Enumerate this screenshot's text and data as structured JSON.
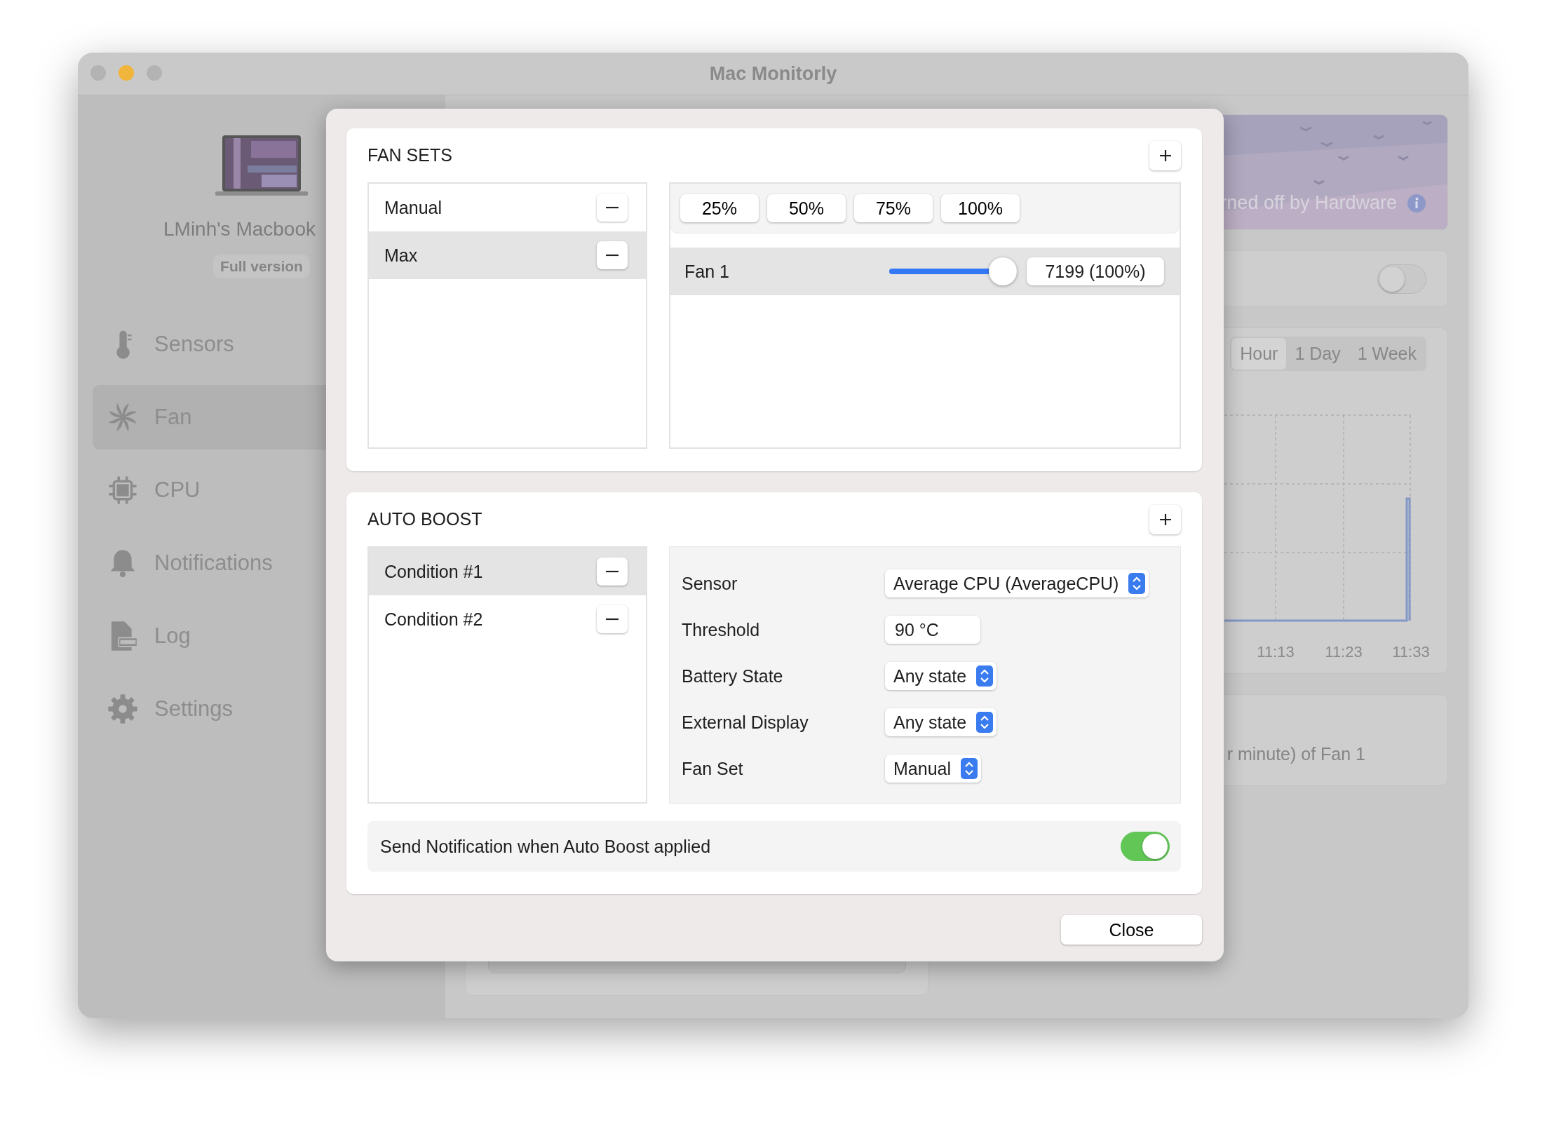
{
  "window": {
    "title": "Mac Monitorly"
  },
  "sidebar": {
    "device_name": "LMinh's Macbook",
    "badge": "Full version",
    "items": [
      {
        "label": "Sensors",
        "kind": "thermometer",
        "selected": false
      },
      {
        "label": "Fan",
        "kind": "fan",
        "selected": true
      },
      {
        "label": "CPU",
        "kind": "chip",
        "selected": false
      },
      {
        "label": "Notifications",
        "kind": "bell",
        "selected": false
      },
      {
        "label": "Log",
        "kind": "log",
        "selected": false
      },
      {
        "label": "Settings",
        "kind": "gear",
        "selected": false
      }
    ]
  },
  "background": {
    "banner_text": "rned off by Hardware",
    "toggle_on": false,
    "range_tabs": [
      {
        "label": "Hour",
        "selected": true
      },
      {
        "label": "1 Day",
        "selected": false
      },
      {
        "label": "1 Week",
        "selected": false
      }
    ],
    "chart_labels": [
      "11:13",
      "11:23",
      "11:33"
    ],
    "footer_text": "r minute) of Fan 1"
  },
  "modal": {
    "fan_sets": {
      "title": "FAN SETS",
      "items": [
        {
          "label": "Manual",
          "selected": false
        },
        {
          "label": "Max",
          "selected": true
        }
      ],
      "presets": [
        "25%",
        "50%",
        "75%",
        "100%"
      ],
      "fans": [
        {
          "name": "Fan 1",
          "level": 1.0,
          "reading": "7199 (100%)"
        }
      ]
    },
    "auto_boost": {
      "title": "AUTO BOOST",
      "conditions": [
        {
          "label": "Condition #1",
          "selected": true
        },
        {
          "label": "Condition #2",
          "selected": false
        }
      ],
      "fields": [
        {
          "label": "Sensor",
          "kind": "popup",
          "value": "Average CPU (AverageCPU)"
        },
        {
          "label": "Threshold",
          "kind": "text",
          "value": "90 °C"
        },
        {
          "label": "Battery State",
          "kind": "popup",
          "value": "Any state"
        },
        {
          "label": "External Display",
          "kind": "popup",
          "value": "Any state"
        },
        {
          "label": "Fan Set",
          "kind": "popup",
          "value": "Manual"
        }
      ],
      "notification": {
        "label": "Send Notification when Auto Boost applied",
        "on": true
      }
    },
    "close_button": "Close"
  }
}
